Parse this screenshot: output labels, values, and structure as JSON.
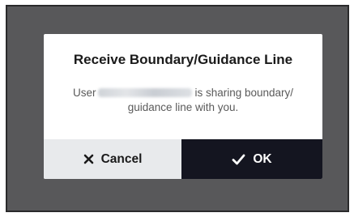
{
  "dialog": {
    "title": "Receive Boundary/Guidance Line",
    "message_prefix": "User",
    "message_line1_suffix": "is sharing boundary/",
    "message_line2": "guidance line with you.",
    "cancel_label": "Cancel",
    "ok_label": "OK"
  },
  "icons": {
    "cancel": "close-icon",
    "ok": "check-icon"
  },
  "colors": {
    "backdrop": "#58585a",
    "dialog_bg": "#ffffff",
    "cancel_bg": "#e8eaec",
    "ok_bg": "#141520"
  }
}
